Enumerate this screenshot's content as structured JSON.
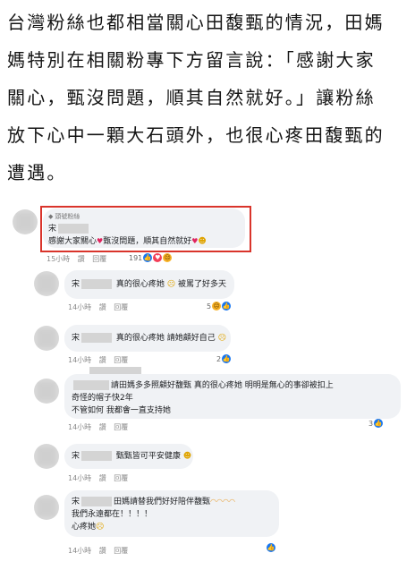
{
  "article": {
    "lines": [
      "台灣粉絲也都相當關心田馥甄的情況，田媽",
      "媽特別在相關粉專下方留言說：「感謝大家",
      "關心，甄沒問題，順其自然就好。」讓粉絲",
      "放下心中一顆大石頭外，也很心疼田馥甄的",
      "遭遇。"
    ]
  },
  "comments": [
    {
      "badge": "頭號粉絲",
      "name": "宋",
      "text": "感謝大家關心",
      "text2": "甄沒問題，順其自然就好",
      "time": "15小時",
      "like": "讚",
      "reply": "回覆",
      "reactions_count": "191"
    },
    {
      "name": "宋",
      "text": "真的很心疼她",
      "text2": "被罵了好多天",
      "time": "14小時",
      "like": "讚",
      "reply": "回覆",
      "reactions_count": "5"
    },
    {
      "name": "宋",
      "text": "真的很心疼她 請她顧好自己",
      "time": "14小時",
      "like": "讚",
      "reply": "回覆",
      "reactions_count": "2"
    },
    {
      "name": "",
      "text": "請田媽多多照顧好馥甄 真的很心疼她 明明是無心的事卻被扣上",
      "text2": "奇怪的帽子快2年",
      "text3": "不管如何 我都會一直支持她",
      "time": "14小時",
      "like": "讚",
      "reply": "回覆",
      "reactions_count": "3"
    },
    {
      "name": "宋",
      "text": "甄甄皆可平安健康",
      "time": "14小時",
      "like": "讚",
      "reply": "回覆"
    },
    {
      "name": "宋",
      "text": "田媽請替我們好好陪伴馥甄",
      "text2": "我們永遠都在！！！！",
      "text3": "心疼她",
      "time": "14小時",
      "like": "讚",
      "reply": "回覆"
    }
  ]
}
